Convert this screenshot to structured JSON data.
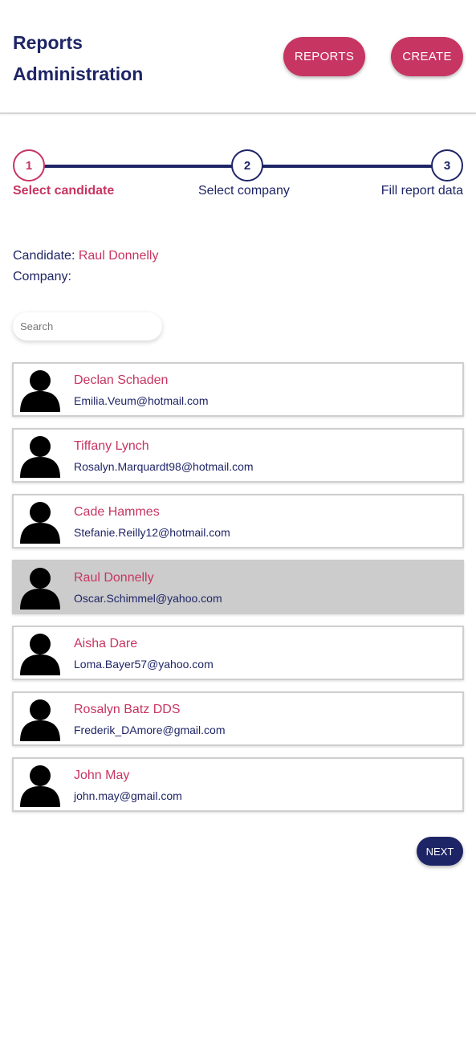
{
  "header": {
    "title_line1": "Reports",
    "title_line2": "Administration",
    "reports_button": "REPORTS",
    "create_button": "CREATE"
  },
  "stepper": {
    "current_step": 1,
    "steps": [
      {
        "number": "1",
        "label": "Select candidate"
      },
      {
        "number": "2",
        "label": "Select company"
      },
      {
        "number": "3",
        "label": "Fill report data"
      }
    ]
  },
  "selection": {
    "candidate_label": "Candidate:",
    "candidate_value": "Raul Donnelly",
    "company_label": "Company:",
    "company_value": ""
  },
  "search": {
    "placeholder": "Search",
    "value": ""
  },
  "candidates": [
    {
      "name": "Declan Schaden",
      "email": "Emilia.Veum@hotmail.com",
      "icon": "person-avatar-icon",
      "selected": false
    },
    {
      "name": "Tiffany Lynch",
      "email": "Rosalyn.Marquardt98@hotmail.com",
      "icon": "person-avatar-icon",
      "selected": false
    },
    {
      "name": "Cade Hammes",
      "email": "Stefanie.Reilly12@hotmail.com",
      "icon": "person-avatar-icon",
      "selected": false
    },
    {
      "name": "Raul Donnelly",
      "email": "Oscar.Schimmel@yahoo.com",
      "icon": "person-avatar-icon",
      "selected": true
    },
    {
      "name": "Aisha Dare",
      "email": "Loma.Bayer57@yahoo.com",
      "icon": "person-avatar-icon",
      "selected": false
    },
    {
      "name": "Rosalyn Batz DDS",
      "email": "Frederik_DAmore@gmail.com",
      "icon": "person-avatar-icon",
      "selected": false
    },
    {
      "name": "John May",
      "email": "john.may@gmail.com",
      "icon": "person-avatar-icon",
      "selected": false
    }
  ],
  "next_button": "NEXT",
  "colors": {
    "primary": "#1e2566",
    "accent": "#c73562",
    "selected_row": "#cccccc"
  }
}
